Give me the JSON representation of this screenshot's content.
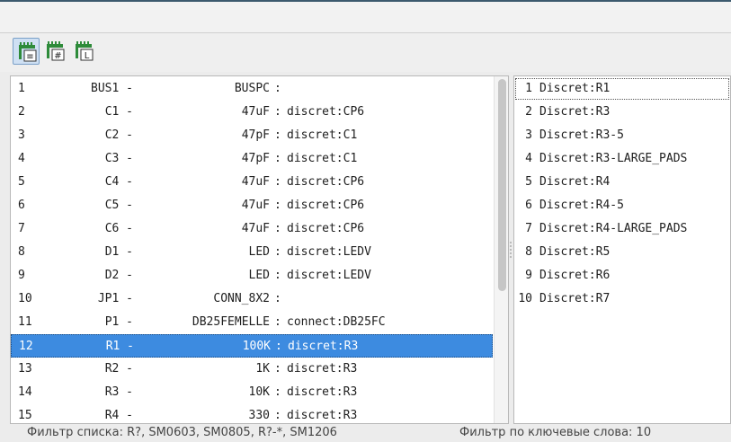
{
  "colors": {
    "selection": "#3d8be0",
    "accent": "#3c5a6e"
  },
  "toolbar": {
    "buttons": [
      {
        "icon": "filter-by-pin-list-icon",
        "glyph": "≡",
        "active": true
      },
      {
        "icon": "filter-by-pin-count-icon",
        "glyph": "#",
        "active": false
      },
      {
        "icon": "filter-by-library-icon",
        "glyph": "L",
        "active": false
      }
    ]
  },
  "components": [
    {
      "num": "1",
      "ref": "BUS1 -",
      "value": "BUSPC",
      "sep": ":",
      "footprint": ""
    },
    {
      "num": "2",
      "ref": "C1 -",
      "value": "47uF",
      "sep": ":",
      "footprint": "discret:CP6"
    },
    {
      "num": "3",
      "ref": "C2 -",
      "value": "47pF",
      "sep": ":",
      "footprint": "discret:C1"
    },
    {
      "num": "4",
      "ref": "C3 -",
      "value": "47pF",
      "sep": ":",
      "footprint": "discret:C1"
    },
    {
      "num": "5",
      "ref": "C4 -",
      "value": "47uF",
      "sep": ":",
      "footprint": "discret:CP6"
    },
    {
      "num": "6",
      "ref": "C5 -",
      "value": "47uF",
      "sep": ":",
      "footprint": "discret:CP6"
    },
    {
      "num": "7",
      "ref": "C6 -",
      "value": "47uF",
      "sep": ":",
      "footprint": "discret:CP6"
    },
    {
      "num": "8",
      "ref": "D1 -",
      "value": "LED",
      "sep": ":",
      "footprint": "discret:LEDV"
    },
    {
      "num": "9",
      "ref": "D2 -",
      "value": "LED",
      "sep": ":",
      "footprint": "discret:LEDV"
    },
    {
      "num": "10",
      "ref": "JP1 -",
      "value": "CONN_8X2",
      "sep": ":",
      "footprint": ""
    },
    {
      "num": "11",
      "ref": "P1 -",
      "value": "DB25FEMELLE",
      "sep": ":",
      "footprint": "connect:DB25FC"
    },
    {
      "num": "12",
      "ref": "R1 -",
      "value": "100K",
      "sep": ":",
      "footprint": "discret:R3",
      "selected": true
    },
    {
      "num": "13",
      "ref": "R2 -",
      "value": "1K",
      "sep": ":",
      "footprint": "discret:R3"
    },
    {
      "num": "14",
      "ref": "R3 -",
      "value": "10K",
      "sep": ":",
      "footprint": "discret:R3"
    },
    {
      "num": "15",
      "ref": "R4 -",
      "value": "330",
      "sep": ":",
      "footprint": "discret:R3"
    }
  ],
  "footprints": [
    {
      "num": "1",
      "name": "Discret:R1"
    },
    {
      "num": "2",
      "name": "Discret:R3"
    },
    {
      "num": "3",
      "name": "Discret:R3-5"
    },
    {
      "num": "4",
      "name": "Discret:R3-LARGE_PADS"
    },
    {
      "num": "5",
      "name": "Discret:R4"
    },
    {
      "num": "6",
      "name": "Discret:R4-5"
    },
    {
      "num": "7",
      "name": "Discret:R4-LARGE_PADS"
    },
    {
      "num": "8",
      "name": "Discret:R5"
    },
    {
      "num": "9",
      "name": "Discret:R6"
    },
    {
      "num": "10",
      "name": "Discret:R7"
    }
  ],
  "status": {
    "left": "Фильтр списка: R?, SM0603, SM0805, R?-*, SM1206",
    "right": "Фильтр по ключевые слова: 10"
  }
}
